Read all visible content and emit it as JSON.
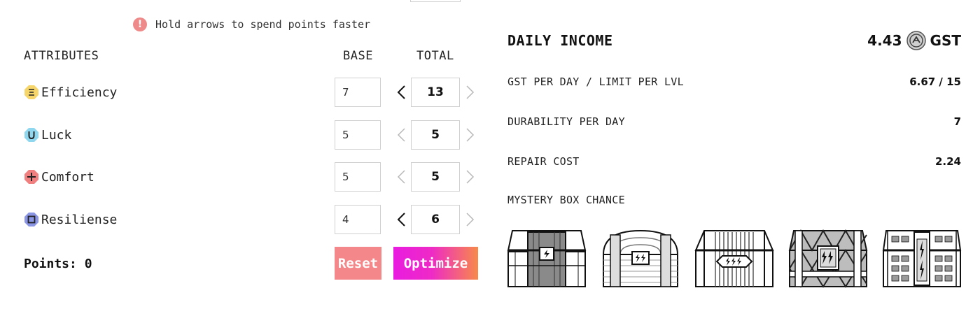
{
  "hint": {
    "icon": "exclamation-icon",
    "text": "Hold arrows to spend points faster"
  },
  "headers": {
    "attributes": "ATTRIBUTES",
    "base": "BASE",
    "total": "TOTAL"
  },
  "attributes": [
    {
      "name": "Efficiency",
      "icon": "efficiency-icon",
      "color": "#f6d56a",
      "base": "7",
      "total": "13"
    },
    {
      "name": "Luck",
      "icon": "luck-icon",
      "color": "#8fd6ef",
      "base": "5",
      "total": "5"
    },
    {
      "name": "Comfort",
      "icon": "comfort-icon",
      "color": "#f07f7f",
      "base": "5",
      "total": "5"
    },
    {
      "name": "Resiliense",
      "icon": "resilience-icon",
      "color": "#8a95e3",
      "base": "4",
      "total": "6"
    }
  ],
  "points": {
    "text": "Points: 0"
  },
  "buttons": {
    "reset": "Reset",
    "optimize": "Optimize"
  },
  "stats": {
    "daily_income_label": "DAILY INCOME",
    "daily_income_value": "4.43",
    "daily_income_unit": "GST",
    "gst_per_day_label": "GST PER DAY / LIMIT PER LVL",
    "gst_per_day_value": "6.67 / 15",
    "durability_label": "DURABILITY PER DAY",
    "durability_value": "7",
    "repair_label": "REPAIR COST",
    "repair_value": "2.24",
    "mystery_label": "MYSTERY BOX CHANCE"
  },
  "mystery_boxes": [
    {
      "icon": "mystery-box-1-icon"
    },
    {
      "icon": "mystery-box-2-icon"
    },
    {
      "icon": "mystery-box-3-icon"
    },
    {
      "icon": "mystery-box-4-icon"
    },
    {
      "icon": "mystery-box-5-icon"
    }
  ],
  "colors": {
    "reset": "#f4878a",
    "optimize_start": "#e81ce0",
    "optimize_end": "#f78a4a",
    "hint": "#ef8a8a"
  }
}
